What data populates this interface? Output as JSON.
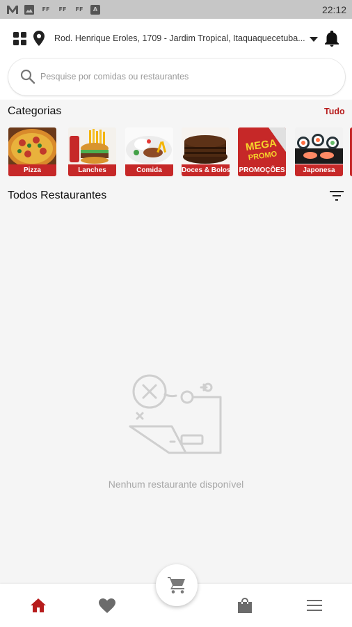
{
  "status_bar": {
    "time": "22:12",
    "icons": [
      "m-app-icon",
      "image-icon",
      "ff-icon",
      "ff-icon",
      "ff-icon",
      "a-app-icon"
    ],
    "ff_label": "FF",
    "a_label": "A"
  },
  "header": {
    "address": "Rod. Henrique Eroles, 1709 - Jardim Tropical, Itaquaquecetuba...",
    "search_placeholder": "Pesquise por comidas ou restaurantes"
  },
  "categories": {
    "title": "Categorias",
    "see_all": "Tudo",
    "items": [
      {
        "label": "Pizza",
        "icon": "pizza-thumbnail"
      },
      {
        "label": "Lanches",
        "icon": "burger-fries-thumbnail"
      },
      {
        "label": "Comida",
        "icon": "plate-meal-thumbnail"
      },
      {
        "label": "Doces & Bolos",
        "icon": "chocolate-cake-thumbnail"
      },
      {
        "label": "PROMOÇÕES",
        "icon": "mega-promo-thumbnail"
      },
      {
        "label": "Japonesa",
        "icon": "sushi-thumbnail"
      }
    ]
  },
  "restaurants": {
    "title": "Todos Restaurantes",
    "empty_message": "Nenhum restaurante disponível"
  },
  "promo_badge": {
    "line1": "MEGA",
    "line2": "PROMO"
  },
  "bottom_nav": {
    "items": [
      "home-icon",
      "heart-icon",
      "cart-icon",
      "bag-icon",
      "menu-icon"
    ],
    "active": "home-icon"
  },
  "colors": {
    "accent": "#b71c1c",
    "category_label_bg": "#c62828",
    "status_bar": "#c6c6c6",
    "background": "#f5f5f5",
    "icon_gray": "#6b6b6b"
  }
}
